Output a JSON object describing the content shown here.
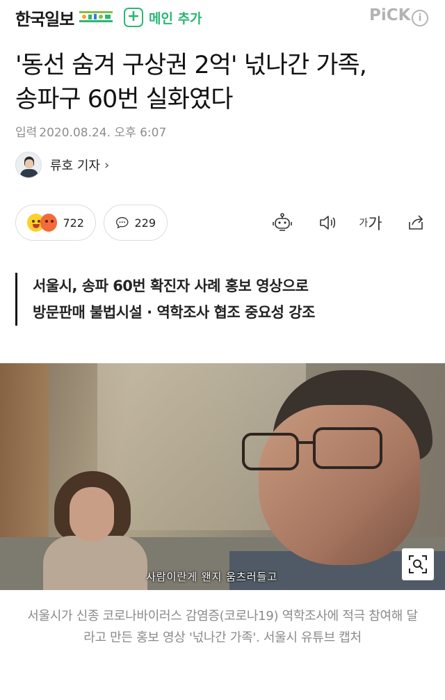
{
  "header": {
    "brand": "한국일보",
    "add_main_label": "메인 추가",
    "plus_symbol": "+",
    "pick_label": "PiCK",
    "info_symbol": "i",
    "accent_color": "#2bb673"
  },
  "article": {
    "title_line1": "'동선 숨겨 구상권 2억' 넋나간 가족,",
    "title_line2": "송파구 60번 실화였다",
    "date_label": "입력",
    "date_value": "2020.08.24. 오후 6:07",
    "reporter_name": "류호 기자",
    "reporter_chevron": "›",
    "reactions_count": "722",
    "comments_count": "229",
    "font_size_small": "가",
    "font_size_large": "가",
    "summary_line1": "서울시, 송파 60번 확진자 사례 홍보 영상으로",
    "summary_line2": "방문판매 불법시설 · 역학조사 협조 중요성 강조"
  },
  "photo": {
    "subtitle": "사람이란게 왠지 움츠러들고",
    "caption": "서울시가 신종 코로나바이러스 감염증(코로나19) 역학조사에 적극 참여해 달라고 만든 홍보 영상 '넋나간 가족'. 서울시 유튜브 캡처"
  },
  "icons": [
    "plus-icon",
    "info-icon",
    "reaction-emoji-icon",
    "comment-icon",
    "robot-icon",
    "speaker-icon",
    "share-icon",
    "zoom-icon",
    "chevron-right-icon"
  ]
}
